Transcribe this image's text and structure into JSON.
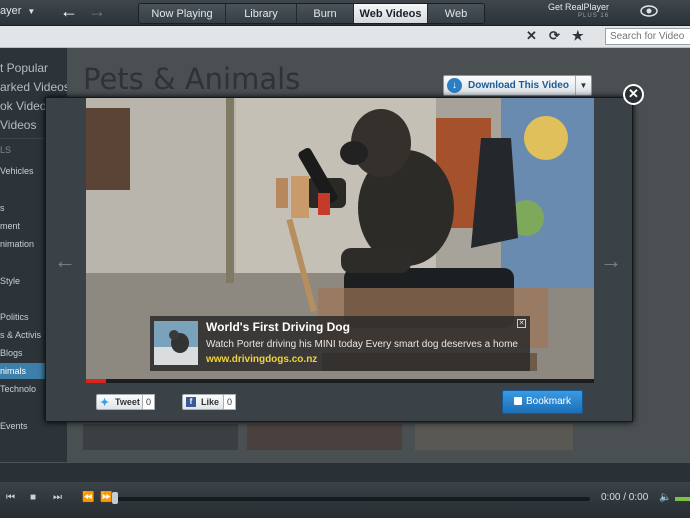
{
  "topbar": {
    "app_menu": "ayer",
    "tabs": [
      {
        "label": "Now Playing"
      },
      {
        "label": "Library"
      },
      {
        "label": "Burn"
      },
      {
        "label": "Web Videos"
      },
      {
        "label": "Web"
      }
    ],
    "active_tab": "Web Videos",
    "brand_name": "Get RealPlayer",
    "brand_version": "PLUS 16"
  },
  "subbar": {
    "search_placeholder": "Search for Video"
  },
  "sidebar": {
    "items": [
      {
        "label": "t Popular"
      },
      {
        "label": "arked Videos"
      },
      {
        "label": "ok Videos"
      },
      {
        "label": "Videos"
      },
      {
        "label": "LS"
      },
      {
        "label": "Vehicles"
      },
      {
        "label": "s"
      },
      {
        "label": "ment"
      },
      {
        "label": "nimation"
      },
      {
        "label": "Style"
      },
      {
        "label": "Politics"
      },
      {
        "label": "s & Activis"
      },
      {
        "label": "Blogs"
      },
      {
        "label": "nimals"
      },
      {
        "label": "Technolo"
      },
      {
        "label": "Events"
      }
    ],
    "selected": "nimals"
  },
  "main": {
    "page_title": "Pets & Animals",
    "download_label": "Download This Video"
  },
  "modal": {
    "ad": {
      "title": "World's First Driving Dog",
      "description": "Watch Porter driving his MINI today Every smart dog deserves a home",
      "link": "www.drivingdogs.co.nz"
    },
    "progress_fraction": 0.04,
    "tweet_label": "Tweet",
    "tweet_count": "0",
    "like_label": "Like",
    "like_count": "0",
    "bookmark_label": "Bookmark"
  },
  "player": {
    "time": "0:00 / 0:00"
  },
  "colors": {
    "accent": "#3d7fa9",
    "bookmark": "#2a85cf",
    "ad_link": "#f0d33a",
    "progress": "#d8261f"
  }
}
